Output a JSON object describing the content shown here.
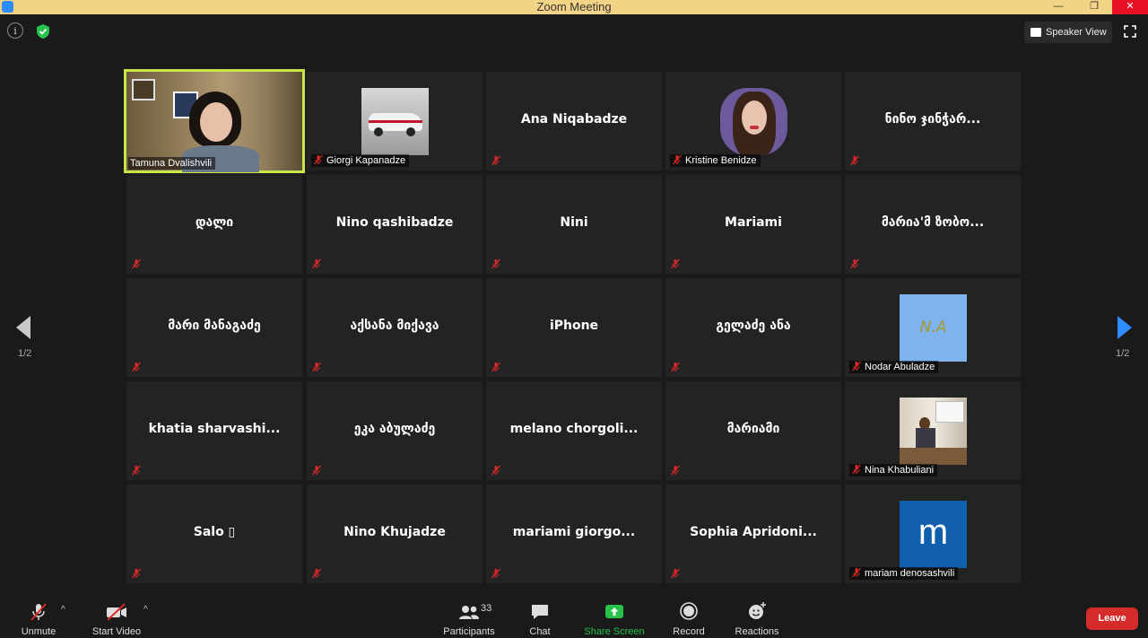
{
  "window": {
    "title": "Zoom Meeting"
  },
  "top_bar": {
    "view_button": "Speaker View"
  },
  "participants": [
    {
      "name": "Tamuna Dvalishvili",
      "display": "",
      "nametag": "Tamuna Dvalishvili",
      "type": "video"
    },
    {
      "name": "Giorgi Kapanadze",
      "display": "",
      "nametag": "Giorgi Kapanadze",
      "type": "photo-car"
    },
    {
      "name": "Ana Niqabadze",
      "display": "Ana Niqabadze",
      "nametag": "",
      "type": "name"
    },
    {
      "name": "Kristine Benidze",
      "display": "",
      "nametag": "Kristine Benidze",
      "type": "photo-person"
    },
    {
      "name": "ნინო ჯინჭარ...",
      "display": "ნინო ჯინჭარ...",
      "nametag": "",
      "type": "name"
    },
    {
      "name": "დალი",
      "display": "დალი",
      "nametag": "",
      "type": "name"
    },
    {
      "name": "Nino qashibadze",
      "display": "Nino qashibadze",
      "nametag": "",
      "type": "name"
    },
    {
      "name": "Nini",
      "display": "Nini",
      "nametag": "",
      "type": "name"
    },
    {
      "name": "Mariami",
      "display": "Mariami",
      "nametag": "",
      "type": "name"
    },
    {
      "name": "მარია'მ ზობო...",
      "display": "მარია'მ ზობო...",
      "nametag": "",
      "type": "name"
    },
    {
      "name": "მარი მანაგაძე",
      "display": "მარი მანაგაძე",
      "nametag": "",
      "type": "name"
    },
    {
      "name": "აქსანა მიქავა",
      "display": "აქსანა მიქავა",
      "nametag": "",
      "type": "name"
    },
    {
      "name": "iPhone",
      "display": "iPhone",
      "nametag": "",
      "type": "name"
    },
    {
      "name": "გელაძე ანა",
      "display": "გელაძე ანა",
      "nametag": "",
      "type": "name"
    },
    {
      "name": "Nodar Abuladze",
      "display": "",
      "nametag": "Nodar Abuladze",
      "type": "avatar-na",
      "avatar_text": "N.A"
    },
    {
      "name": "khatia sharvashi...",
      "display": "khatia  sharvashi...",
      "nametag": "",
      "type": "name"
    },
    {
      "name": "ეკა აბულაძე",
      "display": "ეკა აბულაძე",
      "nametag": "",
      "type": "name"
    },
    {
      "name": "melano chorgoli...",
      "display": "melano  chorgoli...",
      "nametag": "",
      "type": "name"
    },
    {
      "name": "მარიამი",
      "display": "მარიამი",
      "nametag": "",
      "type": "name"
    },
    {
      "name": "Nina Khabuliani",
      "display": "",
      "nametag": "Nina Khabuliani",
      "type": "photo-room"
    },
    {
      "name": "Salo",
      "display": "Salo ▯",
      "nametag": "",
      "type": "name"
    },
    {
      "name": "Nino Khujadze",
      "display": "Nino Khujadze",
      "nametag": "",
      "type": "name"
    },
    {
      "name": "mariami giorgo...",
      "display": "mariami  giorgo...",
      "nametag": "",
      "type": "name"
    },
    {
      "name": "Sophia Apridoni...",
      "display": "Sophia  Apridoni...",
      "nametag": "",
      "type": "name"
    },
    {
      "name": "mariam denosashvili",
      "display": "",
      "nametag": "mariam denosashvili",
      "type": "avatar-m",
      "avatar_text": "m"
    }
  ],
  "pagination": {
    "left": "1/2",
    "right": "1/2"
  },
  "toolbar": {
    "unmute": "Unmute",
    "start_video": "Start Video",
    "participants": "Participants",
    "participant_count": "33",
    "chat": "Chat",
    "share_screen": "Share Screen",
    "record": "Record",
    "reactions": "Reactions",
    "leave": "Leave"
  },
  "colors": {
    "titlebar": "#f3d386",
    "active_speaker": "#c8e64a",
    "share_green": "#27c24c",
    "leave_red": "#d52b2b",
    "nav_blue": "#2d8cff"
  }
}
